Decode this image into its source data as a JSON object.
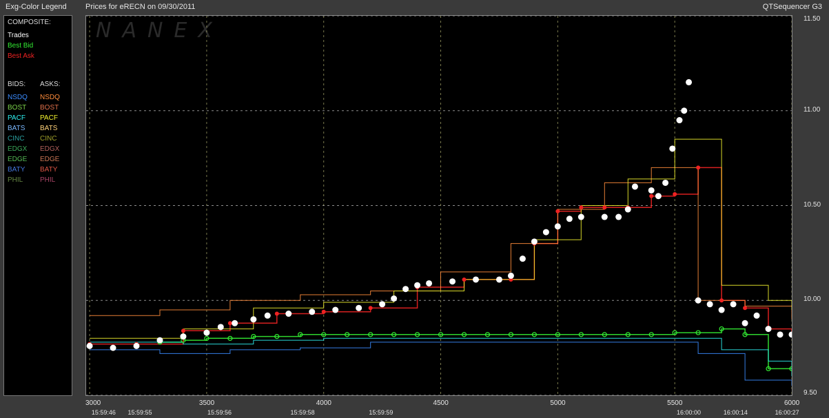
{
  "header": {
    "legend_title": "Exg-Color Legend",
    "chart_title": "Prices for  eRECN  on  09/30/2011",
    "app_name": "QTSequencer G3"
  },
  "watermark": "NANEX",
  "legend": {
    "composite_label": "COMPOSITE:",
    "composite": [
      {
        "label": "Trades",
        "color": "#ffffff"
      },
      {
        "label": "Best Bid",
        "color": "#33ee33"
      },
      {
        "label": "Best Ask",
        "color": "#ee2222"
      }
    ],
    "bids_label": "BIDS:",
    "asks_label": "ASKS:",
    "exchanges": [
      {
        "bid": "NSDQ",
        "ask": "NSDQ",
        "bid_color": "#3b8cff",
        "ask_color": "#ff8c3b"
      },
      {
        "bid": "BOST",
        "ask": "BOST",
        "bid_color": "#7ad14a",
        "ask_color": "#e0704a"
      },
      {
        "bid": "PACF",
        "ask": "PACF",
        "bid_color": "#2ef0f0",
        "ask_color": "#f0f02e"
      },
      {
        "bid": "BATS",
        "ask": "BATS",
        "bid_color": "#7ab8ff",
        "ask_color": "#ffd27a"
      },
      {
        "bid": "CINC",
        "ask": "CINC",
        "bid_color": "#2aa0a0",
        "ask_color": "#a0a02a"
      },
      {
        "bid": "EDGX",
        "ask": "EDGX",
        "bid_color": "#3aa85a",
        "ask_color": "#b0605a"
      },
      {
        "bid": "EDGE",
        "ask": "EDGE",
        "bid_color": "#55bb55",
        "ask_color": "#cc7755"
      },
      {
        "bid": "BATY",
        "ask": "BATY",
        "bid_color": "#4477dd",
        "ask_color": "#dd5544"
      },
      {
        "bid": "PHIL",
        "ask": "PHIL",
        "bid_color": "#668844",
        "ask_color": "#aa4466"
      }
    ]
  },
  "chart_data": {
    "type": "line",
    "title": "Prices for  eRECN  on  09/30/2011",
    "x_ticks": [
      "3000",
      "3500",
      "4000",
      "4500",
      "5000",
      "5500",
      "6000"
    ],
    "time_labels": [
      {
        "seq": 3070,
        "label": "15:59:46"
      },
      {
        "seq": 3225,
        "label": "15:59:55"
      },
      {
        "seq": 3565,
        "label": "15:59:56"
      },
      {
        "seq": 3920,
        "label": "15:59:58"
      },
      {
        "seq": 4255,
        "label": "15:59:59"
      },
      {
        "seq": 5570,
        "label": "16:00:00"
      },
      {
        "seq": 5770,
        "label": "16:00:14"
      },
      {
        "seq": 5990,
        "label": "16:00:27"
      }
    ],
    "y_ticks": [
      "9.50",
      "10.00",
      "10.50",
      "11.00",
      "11.50"
    ],
    "xlim": [
      2985,
      6000
    ],
    "ylim": [
      9.5,
      11.5
    ],
    "grid": true,
    "series": [
      {
        "name": "Trades",
        "color": "#ffffff",
        "x": [
          3000,
          3100,
          3200,
          3300,
          3400,
          3500,
          3560,
          3620,
          3700,
          3760,
          3850,
          3950,
          4050,
          4150,
          4250,
          4300,
          4350,
          4400,
          4450,
          4550,
          4650,
          4750,
          4800,
          4850,
          4900,
          4950,
          5000,
          5050,
          5100,
          5200,
          5260,
          5300,
          5330,
          5400,
          5430,
          5460,
          5490,
          5520,
          5540,
          5560,
          5600,
          5650,
          5700,
          5750,
          5800,
          5850,
          5900,
          5950,
          6000
        ],
        "y": [
          9.76,
          9.75,
          9.76,
          9.79,
          9.81,
          9.83,
          9.86,
          9.88,
          9.9,
          9.92,
          9.93,
          9.94,
          9.95,
          9.96,
          9.98,
          10.01,
          10.06,
          10.08,
          10.09,
          10.1,
          10.11,
          10.11,
          10.13,
          10.22,
          10.31,
          10.36,
          10.39,
          10.43,
          10.44,
          10.44,
          10.44,
          10.48,
          10.6,
          10.58,
          10.55,
          10.62,
          10.8,
          10.95,
          11.0,
          11.15,
          10.0,
          9.98,
          9.95,
          9.98,
          9.88,
          9.92,
          9.85,
          9.82,
          9.82
        ]
      },
      {
        "name": "Best Bid",
        "color": "#33ee33",
        "x": [
          3300,
          3400,
          3500,
          3600,
          3700,
          3800,
          3900,
          4000,
          4100,
          4200,
          4300,
          4400,
          4500,
          4600,
          4700,
          4800,
          4900,
          5000,
          5100,
          5200,
          5300,
          5400,
          5500,
          5600,
          5700,
          5800,
          5900,
          6000
        ],
        "y": [
          9.78,
          9.79,
          9.8,
          9.8,
          9.81,
          9.81,
          9.82,
          9.82,
          9.82,
          9.82,
          9.82,
          9.82,
          9.82,
          9.82,
          9.82,
          9.82,
          9.82,
          9.82,
          9.82,
          9.82,
          9.82,
          9.82,
          9.83,
          9.83,
          9.85,
          9.82,
          9.64,
          9.64
        ]
      },
      {
        "name": "Best Ask",
        "color": "#ee2222",
        "x": [
          3000,
          3200,
          3400,
          3600,
          3800,
          4000,
          4200,
          4400,
          4600,
          4800,
          4900,
          5000,
          5100,
          5200,
          5300,
          5400,
          5500,
          5600,
          5700,
          5800,
          5900,
          6000
        ],
        "y": [
          9.77,
          9.77,
          9.84,
          9.88,
          9.93,
          9.94,
          9.96,
          10.07,
          10.11,
          10.11,
          10.3,
          10.47,
          10.49,
          10.49,
          10.49,
          10.55,
          10.56,
          10.7,
          10.0,
          9.96,
          9.85,
          9.82
        ]
      },
      {
        "name": "NSDQ",
        "color": "#ff8c3b",
        "x": [
          3000,
          3300,
          3600,
          3900,
          4200,
          4500,
          4800,
          5000,
          5200,
          5400,
          5600,
          5800,
          6000
        ],
        "y": [
          9.92,
          9.95,
          10.0,
          10.03,
          10.05,
          10.15,
          10.3,
          10.48,
          10.62,
          10.7,
          10.0,
          9.97,
          9.9
        ]
      },
      {
        "name": "NSDQ",
        "color": "#3b8cff",
        "x": [
          3000,
          3300,
          3600,
          3900,
          4200,
          4500,
          4800,
          5000,
          5200,
          5400,
          5600,
          5800,
          6000
        ],
        "y": [
          9.74,
          9.72,
          9.74,
          9.75,
          9.78,
          9.78,
          9.78,
          9.78,
          9.78,
          9.78,
          9.72,
          9.58,
          9.55
        ]
      },
      {
        "name": "PACF",
        "color": "#f0f02e",
        "x": [
          3000,
          3400,
          3700,
          4000,
          4300,
          4600,
          4900,
          5100,
          5300,
          5500,
          5700,
          5900,
          6000
        ],
        "y": [
          9.8,
          9.85,
          9.96,
          9.99,
          10.05,
          10.11,
          10.32,
          10.5,
          10.64,
          10.85,
          10.08,
          10.0,
          9.95
        ]
      },
      {
        "name": "PACF",
        "color": "#2ef0f0",
        "x": [
          3000,
          3400,
          3700,
          4000,
          4300,
          4600,
          4900,
          5100,
          5300,
          5500,
          5700,
          5900,
          6000
        ],
        "y": [
          9.78,
          9.77,
          9.79,
          9.8,
          9.8,
          9.8,
          9.8,
          9.8,
          9.8,
          9.8,
          9.74,
          9.68,
          9.6
        ]
      }
    ]
  }
}
